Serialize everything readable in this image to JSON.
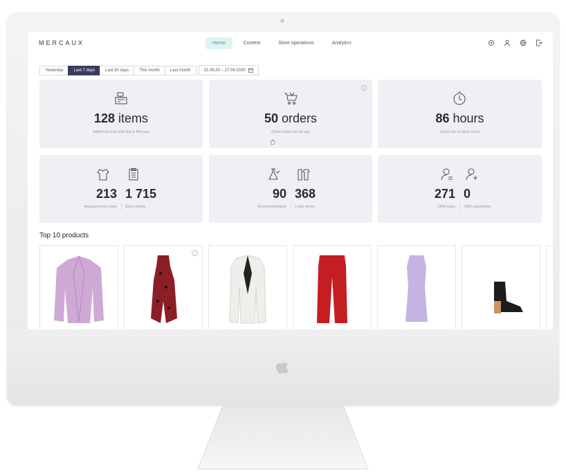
{
  "app": {
    "logo": "MERCAUX"
  },
  "nav": {
    "tabs": [
      {
        "label": "Home",
        "active": true
      },
      {
        "label": "Content",
        "active": false
      },
      {
        "label": "Store operations",
        "active": false
      },
      {
        "label": "Analytics",
        "active": false
      }
    ]
  },
  "header_icons": [
    "settings-icon",
    "user-icon",
    "globe-icon",
    "logout-icon"
  ],
  "filters": {
    "periods": [
      {
        "label": "Yesterday",
        "active": false
      },
      {
        "label": "Last 7 days",
        "active": true
      },
      {
        "label": "Last 30 days",
        "active": false
      },
      {
        "label": "This month",
        "active": false
      },
      {
        "label": "Last month",
        "active": false
      }
    ],
    "date_range": "21.09.20 – 27.09.2020"
  },
  "stats": {
    "items": {
      "value": "128",
      "unit": "items",
      "caption": "Additional items sold due to Mercaux"
    },
    "orders": {
      "value": "50",
      "unit": "orders",
      "caption": "Online orders via the app"
    },
    "hours": {
      "value": "86",
      "unit": "hours",
      "caption": "Saved due to stock check"
    },
    "sales_stock": [
      {
        "value": "213",
        "caption": "Reacquired lost sales"
      },
      {
        "value": "1 715",
        "caption": "Stock checks"
      }
    ],
    "recs_looks": [
      {
        "value": "90",
        "caption": "Recommendations"
      },
      {
        "value": "368",
        "caption": "Looks shown"
      }
    ],
    "crm": [
      {
        "value": "271",
        "caption": "CRM logins"
      },
      {
        "value": "0",
        "caption": "CRM registrations"
      }
    ]
  },
  "products": {
    "title": "Top 10 products",
    "items": [
      {
        "name": "lilac-suede-jacket",
        "color": "#cfa9d6"
      },
      {
        "name": "red-floral-dress",
        "color": "#8b1e26"
      },
      {
        "name": "white-blazer",
        "color": "#f0eeea"
      },
      {
        "name": "red-wide-trousers",
        "color": "#c41d22"
      },
      {
        "name": "lilac-sheath-dress",
        "color": "#c4b3e3"
      },
      {
        "name": "black-suede-ankle-boot",
        "color": "#1c1c1c"
      }
    ]
  },
  "colors": {
    "accent": "#3ea69b",
    "active_filter": "#3b3b5c",
    "card": "#eef0f3"
  }
}
